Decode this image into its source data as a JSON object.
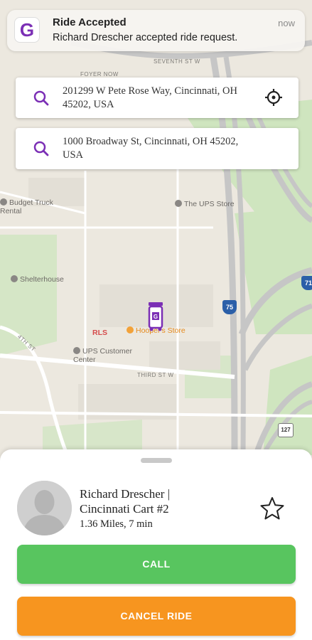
{
  "notification": {
    "app_icon_letter": "G",
    "title": "Ride Accepted",
    "message": "Richard Drescher accepted ride request.",
    "time": "now"
  },
  "pickup": {
    "address": "201299 W Pete Rose Way, Cincinnati, OH 45202, USA"
  },
  "dropoff": {
    "address": "1000 Broadway St, Cincinnati, OH 45202, USA"
  },
  "map": {
    "labels": {
      "budget": "Budget Truck Rental",
      "ups_store": "The UPS Store",
      "shelterhouse": "Shelterhouse",
      "rls": "RLS",
      "hoopers": "Hooper's Store",
      "ups_customer": "UPS Customer Center",
      "third_st": "THIRD ST W",
      "fourth_st": "4TH ST",
      "seventh_st": "SEVENTH ST W",
      "foyer": "FOYER NOW",
      "i75": "75",
      "i71": "71",
      "us127": "127"
    }
  },
  "driver": {
    "name": "Richard Drescher | Cincinnati Cart #2",
    "distance": "1.36 Miles,",
    "eta": "7 min"
  },
  "buttons": {
    "call": "CALL",
    "cancel": "CANCEL RIDE"
  },
  "colors": {
    "brand_purple": "#7b2fb5",
    "call_green": "#58c55f",
    "cancel_orange": "#f7951f"
  }
}
